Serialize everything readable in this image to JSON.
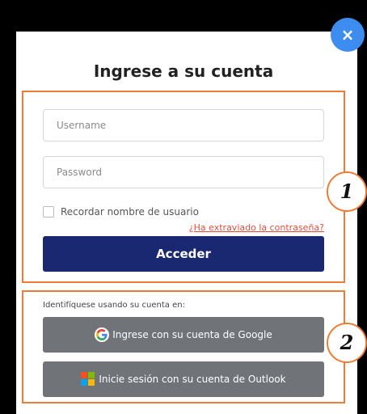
{
  "modal": {
    "title": "Ingrese a su cuenta",
    "close_label": "×"
  },
  "login": {
    "username_placeholder": "Username",
    "password_placeholder": "Password",
    "remember_label": "Recordar nombre de usuario",
    "forgot_link": "¿Ha extraviado la contraseña?",
    "submit_label": "Acceder"
  },
  "social": {
    "intro": "Identifíquese usando su cuenta en:",
    "google_label": "Ingrese con su cuenta de Google",
    "outlook_label": "Inicie sesión con su cuenta de Outlook"
  },
  "annotations": {
    "badge_1": "1",
    "badge_2": "2",
    "highlight_color": "#ec7d37"
  },
  "colors": {
    "primary_button": "#192870",
    "social_button": "#707378",
    "close_button": "#3d8cf0",
    "link": "#e04e3c"
  },
  "icons": {
    "close": "close-icon",
    "google": "google-icon",
    "microsoft": "microsoft-icon"
  }
}
